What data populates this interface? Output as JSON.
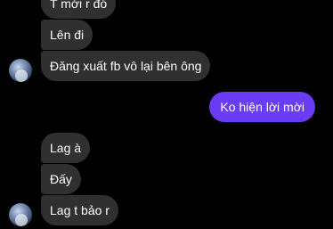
{
  "chat": {
    "messages": [
      {
        "side": "in",
        "text": "T mới r đó"
      },
      {
        "side": "in",
        "text": "Lên đi"
      },
      {
        "side": "in",
        "text": "Đăng xuất fb vô lại bên ông"
      },
      {
        "side": "out",
        "text": "Ko hiện lời mời"
      },
      {
        "side": "in",
        "text": "Lag à"
      },
      {
        "side": "in",
        "text": "Đấy"
      },
      {
        "side": "in",
        "text": "Lag t bảo r"
      }
    ]
  },
  "colors": {
    "background": "#000000",
    "incoming_bubble": "#303030",
    "outgoing_bubble": "#6a3cf5",
    "text": "#ffffff"
  }
}
